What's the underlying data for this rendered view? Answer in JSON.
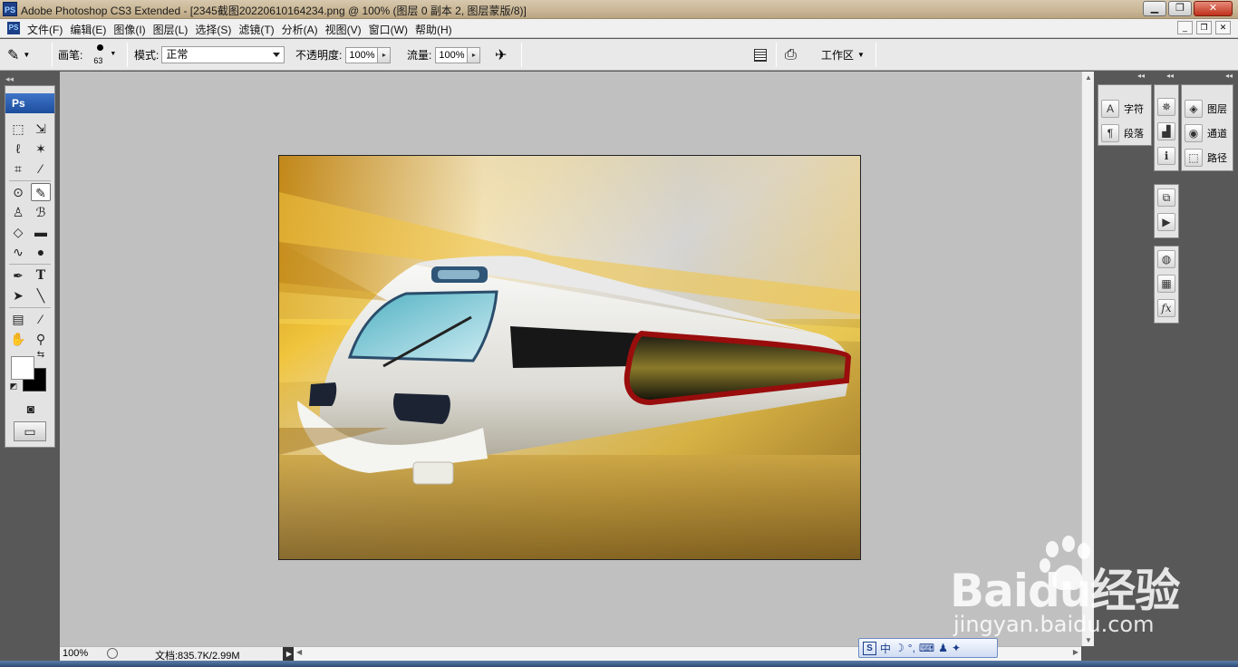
{
  "titlebar": {
    "app_icon": "PS",
    "title": "Adobe Photoshop CS3 Extended - [2345截图20220610164234.png @ 100% (图层 0 副本 2, 图层蒙版/8)]"
  },
  "menubar": {
    "doc_icon": "PS",
    "items": [
      "文件(F)",
      "编辑(E)",
      "图像(I)",
      "图层(L)",
      "选择(S)",
      "滤镜(T)",
      "分析(A)",
      "视图(V)",
      "窗口(W)",
      "帮助(H)"
    ]
  },
  "options": {
    "brush_label": "画笔:",
    "brush_size": "63",
    "mode_label": "模式:",
    "mode_value": "正常",
    "opacity_label": "不透明度:",
    "opacity_value": "100%",
    "flow_label": "流量:",
    "flow_value": "100%",
    "workspace_label": "工作区"
  },
  "toolbox": {
    "header": "Ps"
  },
  "panels": {
    "group1": [
      "字符",
      "段落"
    ],
    "group3": [
      "图层",
      "通道",
      "路径"
    ]
  },
  "status": {
    "zoom": "100%",
    "doc_info": "文档:835.7K/2.99M"
  },
  "watermark": {
    "brand_left": "Bai",
    "brand_right": "du经验",
    "url": "jingyan.baidu.com"
  },
  "ime": {
    "lang": "中"
  }
}
